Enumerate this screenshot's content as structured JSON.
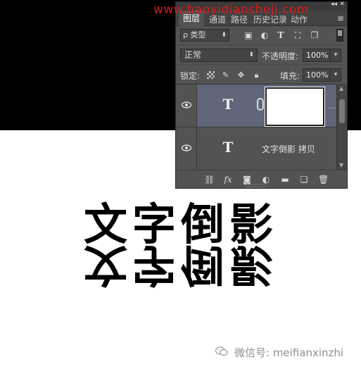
{
  "watermark_url": "www.haoyidiansheji.com",
  "panel": {
    "tabs": [
      "图层",
      "通道",
      "路径",
      "历史记录",
      "动作"
    ],
    "filter": {
      "label": "ρ 类型",
      "icons": [
        "image-filter-icon",
        "adjustment-filter-icon",
        "type-filter-icon",
        "shape-filter-icon",
        "smart-object-filter-icon"
      ]
    },
    "blend_mode": "正常",
    "opacity_label": "不透明度:",
    "opacity_value": "100%",
    "lock_label": "锁定:",
    "fill_label": "填充:",
    "fill_value": "100%",
    "layers": [
      {
        "type_icon": "T",
        "name": "",
        "selected": true,
        "has_mask": true
      },
      {
        "type_icon": "T",
        "name": "文字倒影 拷贝",
        "selected": false,
        "has_mask": false
      }
    ]
  },
  "canvas": {
    "text": "文字倒影",
    "reflection_text": "文字倒影"
  },
  "wechat": {
    "label": "微信号: meifianxinzhi"
  }
}
